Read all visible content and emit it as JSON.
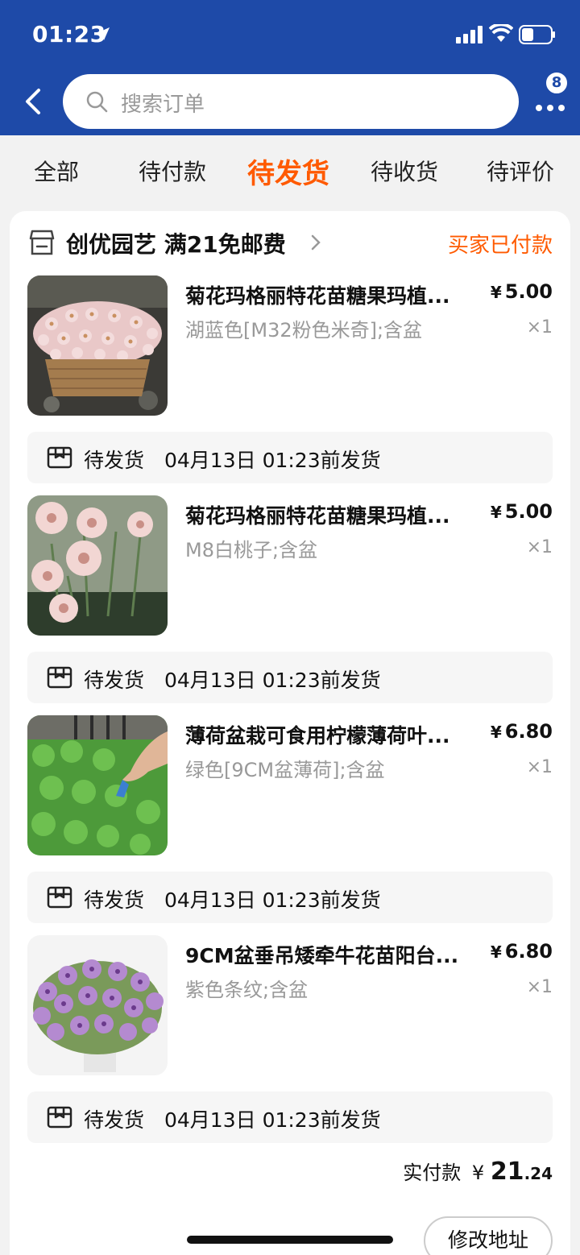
{
  "status_bar": {
    "time": "01:23"
  },
  "search": {
    "placeholder": "搜索订单"
  },
  "header": {
    "badge_count": "8"
  },
  "tabs": [
    {
      "label": "全部"
    },
    {
      "label": "待付款"
    },
    {
      "label": "待发货",
      "active": true
    },
    {
      "label": "待收货"
    },
    {
      "label": "待评价"
    }
  ],
  "shop": {
    "name": "创优园艺 满21免邮费",
    "order_status": "买家已付款"
  },
  "items": [
    {
      "title": "菊花玛格丽特花苗糖果玛植...",
      "sku": "湖蓝色[M32粉色米奇];含盆",
      "price_yen": "¥",
      "price": "5.00",
      "qty": "×1",
      "ship_label": "待发货",
      "ship_date": "04月13日 01:23前发货"
    },
    {
      "title": "菊花玛格丽特花苗糖果玛植...",
      "sku": "M8白桃子;含盆",
      "price_yen": "¥",
      "price": "5.00",
      "qty": "×1",
      "ship_label": "待发货",
      "ship_date": "04月13日 01:23前发货"
    },
    {
      "title": "薄荷盆栽可食用柠檬薄荷叶...",
      "sku": "绿色[9CM盆薄荷];含盆",
      "price_yen": "¥",
      "price": "6.80",
      "qty": "×1",
      "ship_label": "待发货",
      "ship_date": "04月13日 01:23前发货"
    },
    {
      "title": "9CM盆垂吊矮牵牛花苗阳台...",
      "sku": "紫色条纹;含盆",
      "price_yen": "¥",
      "price": "6.80",
      "qty": "×1",
      "ship_label": "待发货",
      "ship_date": "04月13日 01:23前发货"
    }
  ],
  "footer": {
    "total_label": "实付款",
    "total_yen": "¥",
    "total_int": "21",
    "total_dec": ".24",
    "modify_address": "修改地址"
  },
  "colors": {
    "header_blue": "#1e4aa8",
    "accent_orange": "#ff5a00"
  }
}
